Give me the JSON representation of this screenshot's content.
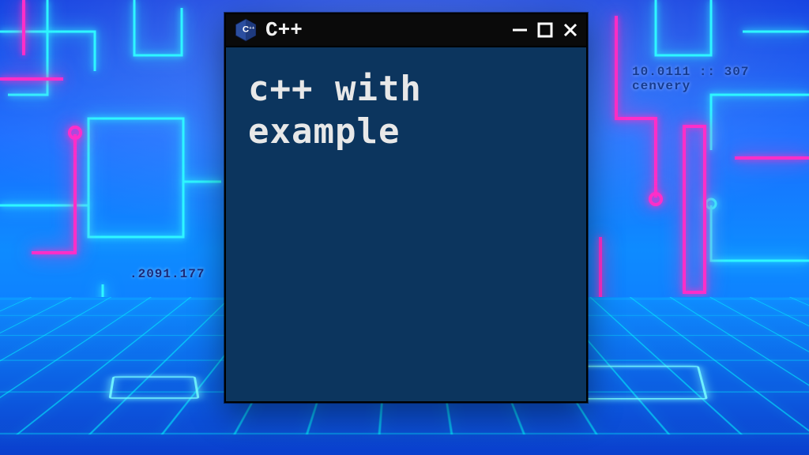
{
  "window": {
    "title": "C++",
    "icon": "cpp-hexagon-icon",
    "content_text": "c++ with\nexample"
  },
  "controls": {
    "minimize": "minimize",
    "maximize": "maximize",
    "close": "close"
  },
  "background": {
    "decorative_labels": [
      ".2091.177",
      "10.0111 :: 307  cenvery"
    ]
  },
  "colors": {
    "terminal_bg": "#0c355e",
    "titlebar_bg": "#0a0a0a",
    "neon_cyan": "#2ef6ff",
    "neon_pink": "#ff2ec8"
  }
}
